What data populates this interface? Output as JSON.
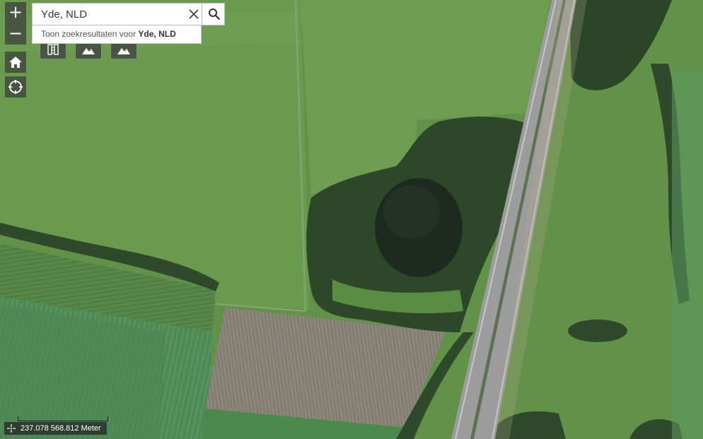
{
  "search": {
    "value": "Yde, NLD",
    "suggestion_prefix": "Toon zoekresultaten voor ",
    "suggestion_term": "Yde, NLD"
  },
  "zoom": {
    "in_label": "+",
    "out_label": "−"
  },
  "status": {
    "x": "237.078",
    "y": "568.812",
    "unit": "Meter"
  },
  "icons": {
    "zoom_in": "plus-icon",
    "zoom_out": "minus-icon",
    "home": "home-icon",
    "locate": "locate-icon",
    "clear": "close-icon",
    "search": "search-icon",
    "coordinates": "crosshair-icon"
  },
  "colors": {
    "control_bg": "#3c3c3c",
    "field": "#5f8c48",
    "road": "#9c9c9c",
    "water": "#1f2b22",
    "forest": "#2f4a2a"
  }
}
